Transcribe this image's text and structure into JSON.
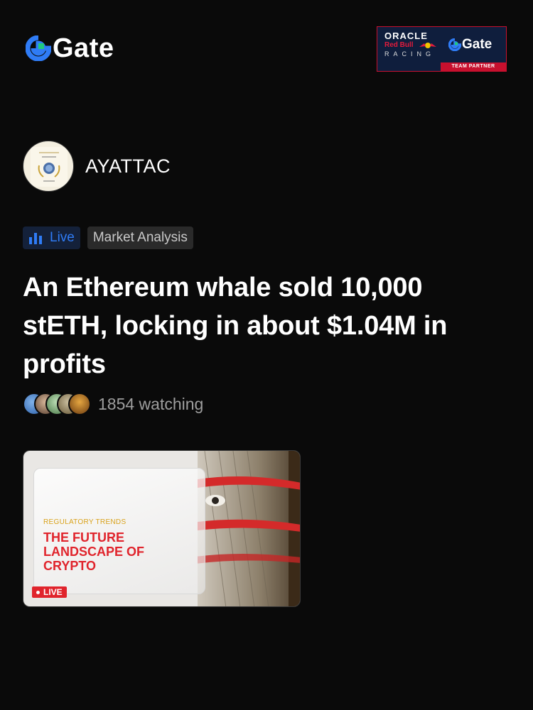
{
  "brand": {
    "name": "Gate",
    "accent": "#2f7cf6",
    "accent_green": "#1fc97e"
  },
  "partner_banner": {
    "line1": "ORACLE",
    "line2": "Red Bull",
    "line3": "RACING",
    "gate_label": "Gate",
    "badge": "TEAM PARTNER"
  },
  "author": {
    "name": "AYATTAC"
  },
  "tags": {
    "live_label": "Live",
    "category": "Market Analysis"
  },
  "post": {
    "title": "An Ethereum whale sold 10,000 stETH, locking in about $1.04M in profits"
  },
  "watchers": {
    "text": "1854 watching"
  },
  "card": {
    "kicker": "REGULATORY TRENDS",
    "headline": "THE FUTURE LANDSCAPE OF CRYPTO",
    "live_badge": "LIVE"
  }
}
